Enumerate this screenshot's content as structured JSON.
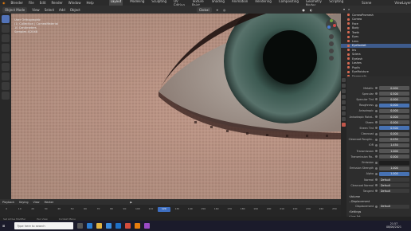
{
  "title": {
    "app": "Blender"
  },
  "menu": [
    "File",
    "Edit",
    "Render",
    "Window",
    "Help"
  ],
  "workspaces": [
    "Layout",
    "Modeling",
    "Sculpting",
    "UV Editing",
    "Texture Paint",
    "Shading",
    "Animation",
    "Rendering",
    "Compositing",
    "Geometry Nodes",
    "Scripting"
  ],
  "active_workspace": "Layout",
  "viewport_header": {
    "mode": "Object Mode",
    "items": [
      "View",
      "Select",
      "Add",
      "Object"
    ],
    "shading": "Global"
  },
  "viewport_info": [
    "User Orthographic",
    "(1) Collection | CorneaMaterial",
    "10 Centimeters",
    "Samples 4/2048"
  ],
  "scene": {
    "scene": "Scene",
    "view_layer": "ViewLayer"
  },
  "outliner": {
    "items": [
      "CorneaPromesh",
      "Cornea",
      "Face",
      "Body",
      "Teeth",
      "Eyes",
      "Lens",
      "EyeSocket",
      "Iris",
      "Sclera",
      "Eyelash",
      "Lashes",
      "Pupils",
      "EyeMoisture",
      "Fingernails",
      "Cornea"
    ],
    "selected_index": 7
  },
  "properties": {
    "rows": [
      {
        "label": "Metallic",
        "value": "0.000",
        "style": "normal"
      },
      {
        "label": "Specular",
        "value": "0.500",
        "style": "normal"
      },
      {
        "label": "Specular Tint",
        "value": "0.000",
        "style": "normal"
      },
      {
        "label": "Roughness",
        "value": "0.000",
        "style": "blue"
      },
      {
        "label": "Anisotropic",
        "value": "0.000",
        "style": "normal"
      },
      {
        "label": "Anisotropic Rotat..",
        "value": "0.000",
        "style": "normal"
      },
      {
        "label": "Sheen",
        "value": "0.000",
        "style": "normal"
      },
      {
        "label": "Sheen Tint",
        "value": "0.500",
        "style": "blue"
      },
      {
        "label": "Clearcoat",
        "value": "0.000",
        "style": "normal"
      },
      {
        "label": "Clearcoat Roughn..",
        "value": "0.030",
        "style": "normal"
      },
      {
        "label": "IOR",
        "value": "1.450",
        "style": "normal"
      },
      {
        "label": "Transmission",
        "value": "1.000",
        "style": "normal"
      },
      {
        "label": "Transmission Ro..",
        "value": "0.000",
        "style": "normal"
      },
      {
        "label": "Emission",
        "value": "",
        "style": "dark"
      },
      {
        "label": "Emission Strength",
        "value": "1.000",
        "style": "normal"
      },
      {
        "label": "Alpha",
        "value": "1.000",
        "style": "blue"
      },
      {
        "label": "Normal",
        "value": "Default",
        "style": "left"
      },
      {
        "label": "Clearcoat Normal",
        "value": "Default",
        "style": "left"
      },
      {
        "label": "Tangent",
        "value": "Default",
        "style": "left"
      }
    ],
    "sections": [
      "Volume",
      "Displacement"
    ],
    "displacement_row": {
      "label": "Displacement",
      "value": "Default"
    },
    "bottom_sections": [
      "Settings",
      "Line Art"
    ]
  },
  "timeline": {
    "items": [
      "Playback",
      "Keying",
      "View",
      "Marker"
    ],
    "ruler": [
      "0",
      "10",
      "20",
      "30",
      "40",
      "50",
      "60",
      "70",
      "80",
      "90",
      "100",
      "110",
      "120",
      "130",
      "140",
      "150",
      "160",
      "170",
      "180",
      "190",
      "200",
      "210",
      "220",
      "230",
      "240",
      "250"
    ],
    "current_frame": "120"
  },
  "statusbar": [
    "Set Active Modifier",
    "Pan View",
    "Context Menu"
  ],
  "taskbar": {
    "search_placeholder": "Type here to search",
    "time": "21:57",
    "date": "08/06/2021"
  },
  "colors": {
    "accent": "#4772b3",
    "selection": "#3e5b8c",
    "material_dot": "#d56a52"
  }
}
